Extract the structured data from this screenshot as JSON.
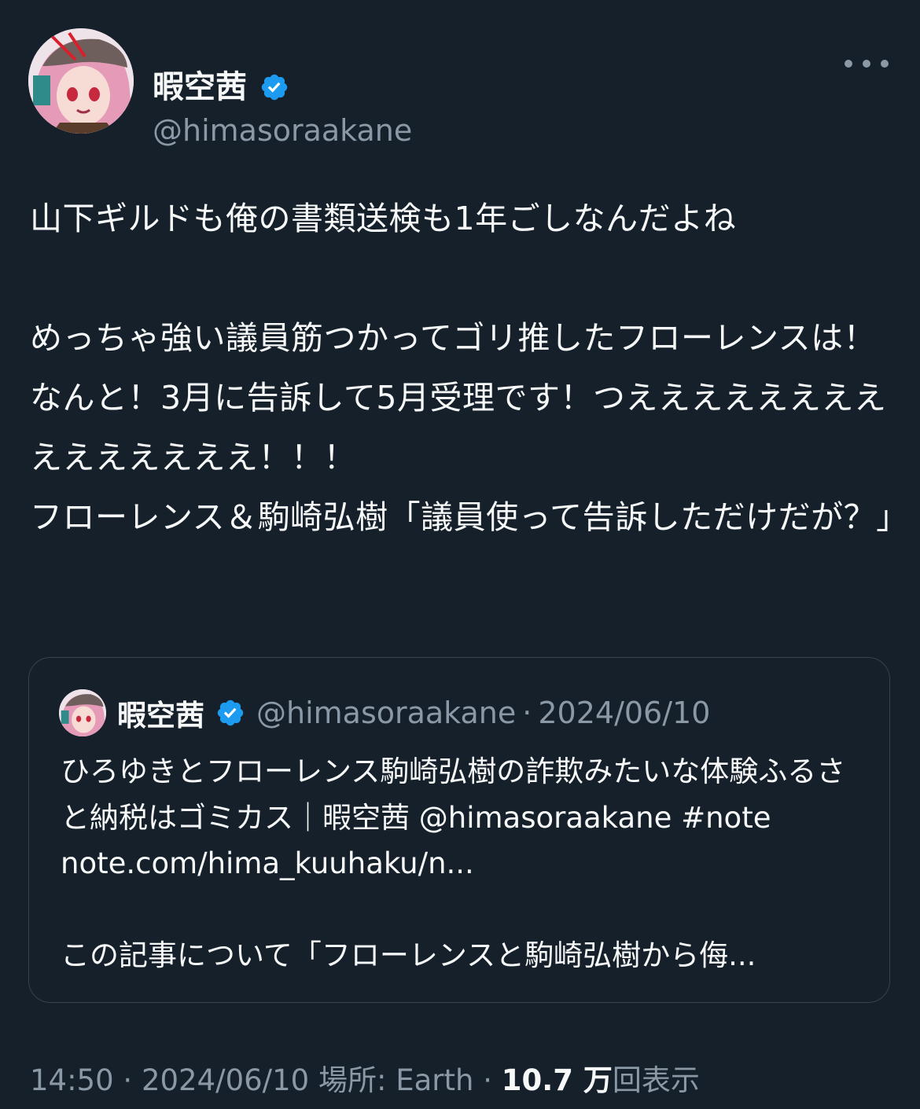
{
  "author": {
    "display_name": "暇空茜",
    "handle": "@himasoraakane"
  },
  "tweet": {
    "text": "山下ギルドも俺の書類送検も1年ごしなんだよね\n\nめっちゃ強い議員筋つかってゴリ推したフローレンスは！なんと！3月に告訴して5月受理です！つえええええええええええええええ！！！\nフローレンス＆駒崎弘樹「議員使って告訴しただけだが？」"
  },
  "quote": {
    "display_name": "暇空茜",
    "handle": "@himasoraakane",
    "separator": "·",
    "date": "2024/06/10",
    "text": "ひろゆきとフローレンス駒崎弘樹の詐欺みたいな体験ふるさと納税はゴミカス｜暇空茜 @himasoraakane #note note.com/hima_kuuhaku/n...\n\nこの記事について「フローレンスと駒崎弘樹から侮..."
  },
  "meta": {
    "time": "14:50",
    "sep1": "·",
    "date": "2024/06/10",
    "location": "場所: Earth",
    "sep2": "·",
    "views_count": "10.7 万",
    "views_label": "回表示"
  },
  "icons": {
    "verified": "verified-badge-icon",
    "more": "more-options-icon"
  },
  "colors": {
    "background": "#15202b",
    "text": "#f7f9f9",
    "secondary": "#8b98a5",
    "verified": "#1d9bf0",
    "border": "#38444d"
  }
}
